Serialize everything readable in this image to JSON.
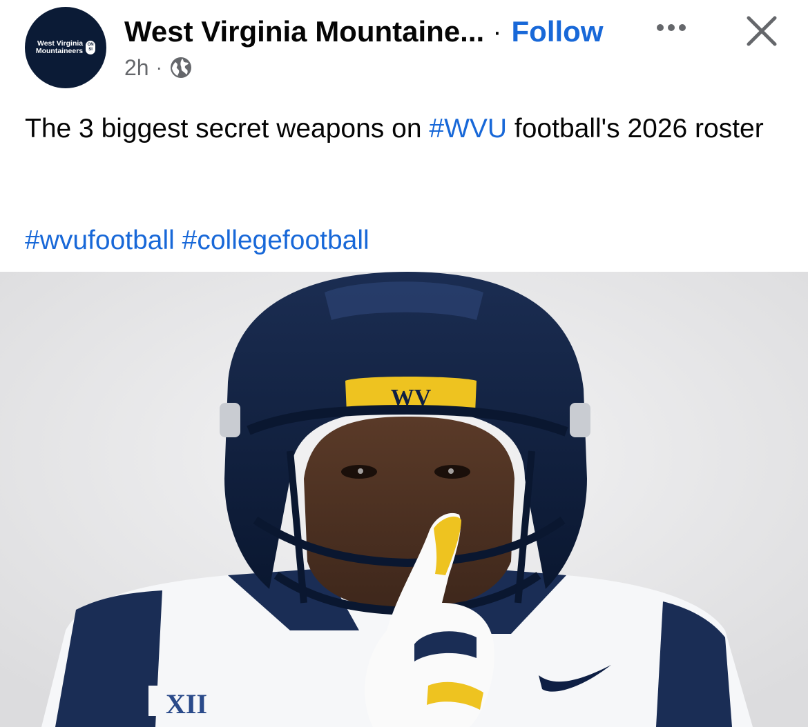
{
  "header": {
    "page_name": "West Virginia Mountaine...",
    "separator": "·",
    "follow_label": "Follow",
    "time": "2h",
    "meta_separator": "·",
    "privacy_icon": "globe-icon",
    "more_icon": "more-options-icon",
    "close_icon": "close-icon"
  },
  "avatar": {
    "line1": "West Virginia",
    "line2": "Mountaineers",
    "badge_top": "ON",
    "badge_bottom": "SI",
    "background": "#0b1b36"
  },
  "post": {
    "text_before": "The 3 biggest secret weapons on ",
    "inline_hashtag": "#WVU",
    "text_after": " football's 2026 roster",
    "hashtags": [
      "#wvufootball",
      "#collegefootball"
    ]
  },
  "media": {
    "helmet_logo_text": "WV",
    "jersey_patch_text": "XII"
  },
  "colors": {
    "link": "#1868d8",
    "text": "#050505",
    "meta": "#65676b",
    "navy": "#0e1f44",
    "gold": "#eec320"
  }
}
